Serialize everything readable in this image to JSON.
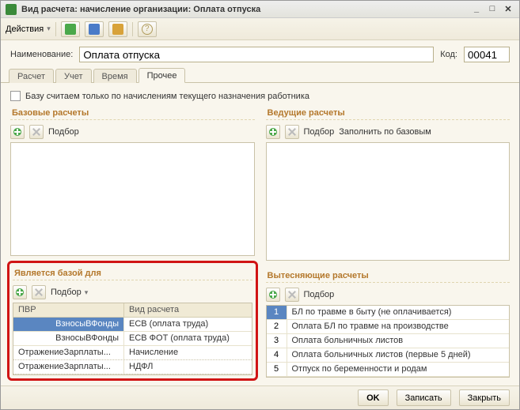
{
  "window": {
    "title": "Вид расчета: начисление организации: Оплата отпуска"
  },
  "toolbar": {
    "actions_label": "Действия"
  },
  "name_row": {
    "name_label": "Наименование:",
    "name_value": "Оплата отпуска",
    "code_label": "Код:",
    "code_value": "00041"
  },
  "tabs": [
    {
      "label": "Расчет"
    },
    {
      "label": "Учет"
    },
    {
      "label": "Время"
    },
    {
      "label": "Прочее"
    }
  ],
  "checkbox_label": "Базу считаем только по начислениям текущего назначения работника",
  "panels": {
    "base": {
      "title": "Базовые расчеты",
      "podbor": "Подбор"
    },
    "leading": {
      "title": "Ведущие расчеты",
      "podbor": "Подбор",
      "fill": "Заполнить по базовым"
    },
    "isBaseFor": {
      "title": "Является базой для",
      "podbor": "Подбор",
      "col1": "ПВР",
      "col2": "Вид расчета",
      "rows": [
        {
          "c1": "ВзносыВФонды",
          "c2": "ЕСВ (оплата труда)"
        },
        {
          "c1": "ВзносыВФонды",
          "c2": "ЕСВ ФОТ (оплата труда)"
        },
        {
          "c1": "ОтражениеЗарплаты...",
          "c2": "Начисление"
        },
        {
          "c1": "ОтражениеЗарплаты...",
          "c2": "НДФЛ"
        }
      ]
    },
    "displacing": {
      "title": "Вытесняющие расчеты",
      "podbor": "Подбор",
      "rows": [
        {
          "n": "1",
          "t": "БЛ по травме в быту (не оплачивается)"
        },
        {
          "n": "2",
          "t": "Оплата БЛ по травме на производстве"
        },
        {
          "n": "3",
          "t": "Оплата больничных листов"
        },
        {
          "n": "4",
          "t": "Оплата больничных листов (первые 5 дней)"
        },
        {
          "n": "5",
          "t": "Отпуск по беременности и родам"
        }
      ]
    }
  },
  "footer": {
    "ok": "OK",
    "save": "Записать",
    "close": "Закрыть"
  }
}
